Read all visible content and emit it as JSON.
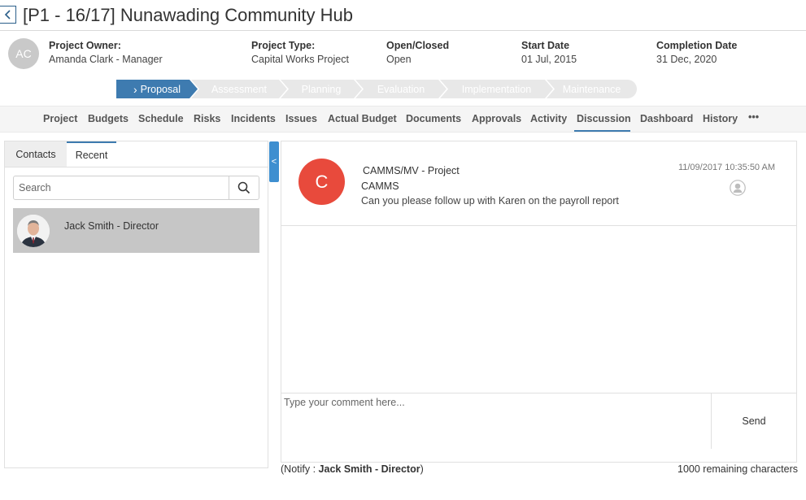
{
  "title": "[P1 - 16/17] Nunawading Community Hub",
  "owner": {
    "initials": "AC",
    "label": "Project Owner:",
    "value": "Amanda Clark - Manager"
  },
  "meta": [
    {
      "label": "Project Type:",
      "value": "Capital Works Project"
    },
    {
      "label": "Open/Closed",
      "value": "Open"
    },
    {
      "label": "Start Date",
      "value": "01 Jul, 2015"
    },
    {
      "label": "Completion Date",
      "value": "31 Dec, 2020"
    }
  ],
  "stages": [
    "Proposal",
    "Assessment",
    "Planning",
    "Evaluation",
    "Implementation",
    "Maintenance"
  ],
  "active_stage": "Proposal",
  "tabs": [
    "Project",
    "Budgets",
    "Schedule",
    "Risks",
    "Incidents",
    "Issues",
    "Actual Budget",
    "Documents",
    "Approvals",
    "Activity",
    "Discussion",
    "Dashboard",
    "History"
  ],
  "active_tab": "Discussion",
  "more_label": "•••",
  "left_tabs": {
    "contacts": "Contacts",
    "recent": "Recent"
  },
  "search": {
    "placeholder": "Search"
  },
  "contact": {
    "name": "Jack Smith - Director"
  },
  "collapse_glyph": "<",
  "message": {
    "initial": "C",
    "context": "CAMMS/MV - Project",
    "author": "CAMMS",
    "text": "Can you please follow up with Karen on the payroll report",
    "time": "11/09/2017 10:35:50 AM"
  },
  "comment": {
    "placeholder": "Type your comment here...",
    "send": "Send"
  },
  "notify": {
    "prefix": "(Notify : ",
    "name": "Jack Smith - Director",
    "suffix": ")"
  },
  "remaining": "1000 remaining characters",
  "colors": {
    "accent": "#3e7bb0",
    "avatar_red": "#e84a3c",
    "stage_inactive": "#e8e8e8",
    "contact_selected": "#c6c6c6"
  }
}
